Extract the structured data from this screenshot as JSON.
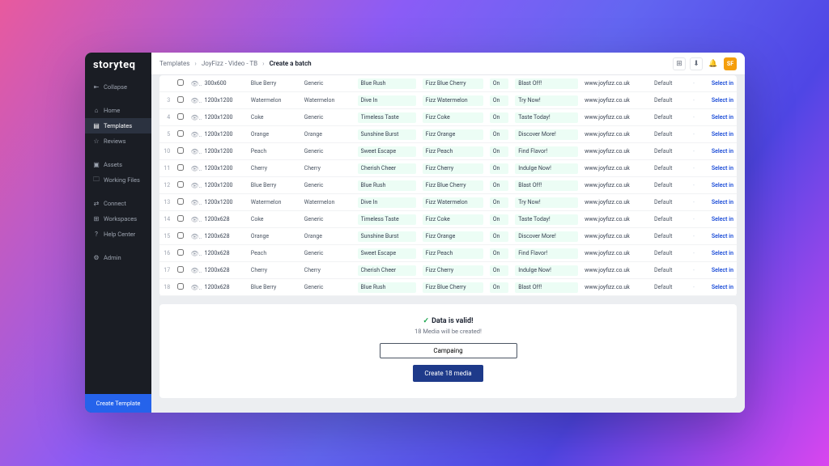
{
  "logo": "storyteq",
  "sidebar": {
    "items": [
      {
        "icon": "⇤",
        "label": "Collapse"
      },
      {
        "icon": "⌂",
        "label": "Home"
      },
      {
        "icon": "▤",
        "label": "Templates",
        "active": true
      },
      {
        "icon": "☆",
        "label": "Reviews"
      },
      {
        "icon": "▣",
        "label": "Assets"
      },
      {
        "icon": "🗀",
        "label": "Working Files"
      },
      {
        "icon": "⇄",
        "label": "Connect"
      },
      {
        "icon": "⊞",
        "label": "Workspaces"
      },
      {
        "icon": "?",
        "label": "Help Center"
      },
      {
        "icon": "⚙",
        "label": "Admin"
      }
    ],
    "create": "Create Template"
  },
  "breadcrumbs": [
    "Templates",
    "JoyFizz - Video - TB",
    "Create a batch"
  ],
  "avatar": "SF",
  "rows": [
    {
      "n": "",
      "dim": "300x600",
      "flavor": "Blue Berry",
      "variant": "Generic",
      "headline": "Blue Rush",
      "product": "Fizz Blue Cherry",
      "on": "On",
      "cta": "Blast Off!",
      "url": "www.joyfizz.co.uk",
      "def": "Default"
    },
    {
      "n": "3",
      "dim": "1200x1200",
      "flavor": "Watermelon",
      "variant": "Watermelon",
      "headline": "Dive In",
      "product": "Fizz Watermelon",
      "on": "On",
      "cta": "Try Now!",
      "url": "www.joyfizz.co.uk",
      "def": "Default"
    },
    {
      "n": "4",
      "dim": "1200x1200",
      "flavor": "Coke",
      "variant": "Generic",
      "headline": "Timeless Taste",
      "product": "Fizz Coke",
      "on": "On",
      "cta": "Taste Today!",
      "url": "www.joyfizz.co.uk",
      "def": "Default"
    },
    {
      "n": "5",
      "dim": "1200x1200",
      "flavor": "Orange",
      "variant": "Orange",
      "headline": "Sunshine Burst",
      "product": "Fizz Orange",
      "on": "On",
      "cta": "Discover More!",
      "url": "www.joyfizz.co.uk",
      "def": "Default"
    },
    {
      "n": "10",
      "dim": "1200x1200",
      "flavor": "Peach",
      "variant": "Generic",
      "headline": "Sweet Escape",
      "product": "Fizz Peach",
      "on": "On",
      "cta": "Find Flavor!",
      "url": "www.joyfizz.co.uk",
      "def": "Default"
    },
    {
      "n": "11",
      "dim": "1200x1200",
      "flavor": "Cherry",
      "variant": "Cherry",
      "headline": "Cherish Cheer",
      "product": "Fizz Cherry",
      "on": "On",
      "cta": "Indulge Now!",
      "url": "www.joyfizz.co.uk",
      "def": "Default"
    },
    {
      "n": "12",
      "dim": "1200x1200",
      "flavor": "Blue Berry",
      "variant": "Generic",
      "headline": "Blue Rush",
      "product": "Fizz Blue Cherry",
      "on": "On",
      "cta": "Blast Off!",
      "url": "www.joyfizz.co.uk",
      "def": "Default"
    },
    {
      "n": "13",
      "dim": "1200x1200",
      "flavor": "Watermelon",
      "variant": "Watermelon",
      "headline": "Dive In",
      "product": "Fizz Watermelon",
      "on": "On",
      "cta": "Try Now!",
      "url": "www.joyfizz.co.uk",
      "def": "Default"
    },
    {
      "n": "14",
      "dim": "1200x628",
      "flavor": "Coke",
      "variant": "Generic",
      "headline": "Timeless Taste",
      "product": "Fizz Coke",
      "on": "On",
      "cta": "Taste Today!",
      "url": "www.joyfizz.co.uk",
      "def": "Default"
    },
    {
      "n": "15",
      "dim": "1200x628",
      "flavor": "Orange",
      "variant": "Orange",
      "headline": "Sunshine Burst",
      "product": "Fizz Orange",
      "on": "On",
      "cta": "Discover More!",
      "url": "www.joyfizz.co.uk",
      "def": "Default"
    },
    {
      "n": "16",
      "dim": "1200x628",
      "flavor": "Peach",
      "variant": "Generic",
      "headline": "Sweet Escape",
      "product": "Fizz Peach",
      "on": "On",
      "cta": "Find Flavor!",
      "url": "www.joyfizz.co.uk",
      "def": "Default"
    },
    {
      "n": "17",
      "dim": "1200x628",
      "flavor": "Cherry",
      "variant": "Cherry",
      "headline": "Cherish Cheer",
      "product": "Fizz Cherry",
      "on": "On",
      "cta": "Indulge Now!",
      "url": "www.joyfizz.co.uk",
      "def": "Default"
    },
    {
      "n": "18",
      "dim": "1200x628",
      "flavor": "Blue Berry",
      "variant": "Generic",
      "headline": "Blue Rush",
      "product": "Fizz Blue Cherry",
      "on": "On",
      "cta": "Blast Off!",
      "url": "www.joyfizz.co.uk",
      "def": "Default"
    }
  ],
  "select_label": "Select in",
  "validation": {
    "title": "Data is valid!",
    "sub": "18 Media will be created!",
    "campaign": "Campaing",
    "button": "Create 18 media"
  }
}
